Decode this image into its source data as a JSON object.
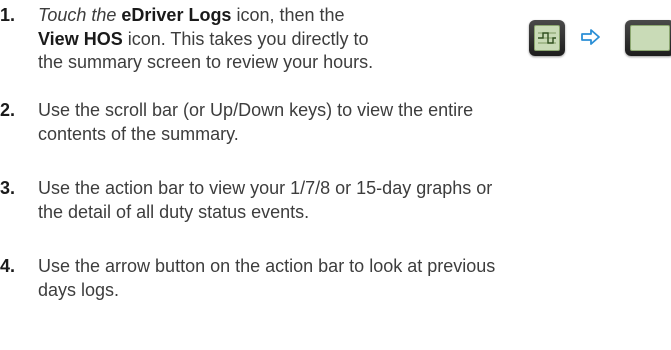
{
  "steps": [
    {
      "number": "1.",
      "lines": [
        {
          "a": "Touch the ",
          "b": "eDriver Logs",
          "c": " icon, then the"
        },
        {
          "b": "View HOS",
          "c": " icon. This takes you directly to"
        },
        {
          "c": "the summary screen to review your hours."
        }
      ]
    },
    {
      "number": "2.",
      "lines": [
        "Use the scroll bar (or Up/Down keys) to view the entire",
        "contents of the summary."
      ]
    },
    {
      "number": "3.",
      "lines": [
        "Use the action bar to view your 1/7/8 or 15-day graphs or",
        "the detail of all duty status events."
      ]
    },
    {
      "number": "4.",
      "lines": [
        "Use the arrow button on the action bar to look at previous",
        "days logs."
      ]
    }
  ],
  "icons": {
    "first": "edriver-logs-icon",
    "arrow": "right-arrow-icon",
    "second": "view-hos-icon",
    "arrow_color": "#2b8fd6"
  }
}
